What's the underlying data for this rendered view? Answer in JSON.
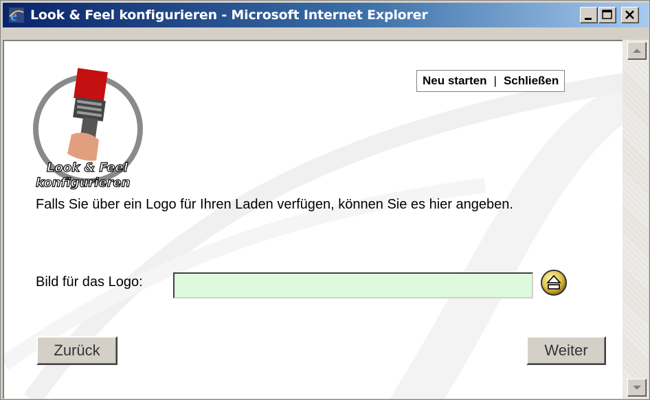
{
  "window": {
    "title": "Look & Feel konfigurieren - Microsoft Internet Explorer",
    "icon": "ie-icon",
    "controls": [
      "minimize-icon",
      "maximize-icon",
      "close-icon"
    ]
  },
  "logo": {
    "line1": "Look & Feel",
    "line2": "konfigurieren",
    "icon": "paintbrush-icon"
  },
  "toplinks": {
    "restart": "Neu starten",
    "separator": "|",
    "close": "Schließen"
  },
  "intro": "Falls Sie über ein Logo für Ihren Laden verfügen, können Sie es hier angeben.",
  "form": {
    "label": "Bild für das Logo:",
    "value": "",
    "placeholder": "",
    "upload_icon": "upload-icon"
  },
  "buttons": {
    "back": "Zurück",
    "next": "Weiter"
  },
  "colors": {
    "titlebar_start": "#0a246a",
    "titlebar_end": "#a6caf0",
    "input_bg": "#ddfadd",
    "chrome": "#d4d0c8"
  }
}
